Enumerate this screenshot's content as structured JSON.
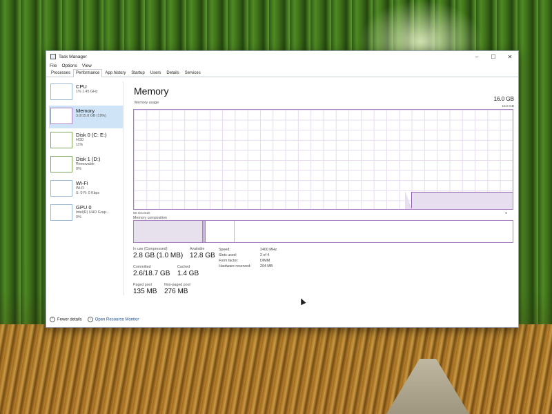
{
  "window": {
    "title": "Task Manager",
    "controls": {
      "minimize": "–",
      "maximize": "☐",
      "close": "✕"
    }
  },
  "menu": [
    "File",
    "Options",
    "View"
  ],
  "tabs": [
    "Processes",
    "Performance",
    "App history",
    "Startup",
    "Users",
    "Details",
    "Services"
  ],
  "active_tab": "Performance",
  "sidebar": {
    "items": [
      {
        "title": "CPU",
        "sub1": "1% 1.45 GHz",
        "sub2": ""
      },
      {
        "title": "Memory",
        "sub1": "3.0/15.8 GB (19%)",
        "sub2": ""
      },
      {
        "title": "Disk 0 (C: E:)",
        "sub1": "HDD",
        "sub2": "11%"
      },
      {
        "title": "Disk 1 (D:)",
        "sub1": "Removable",
        "sub2": "0%"
      },
      {
        "title": "Wi-Fi",
        "sub1": "Wi-Fi",
        "sub2": "S: 0 R: 0 Kbps"
      },
      {
        "title": "GPU 0",
        "sub1": "Intel(R) UHD Grap...",
        "sub2": "0%"
      }
    ]
  },
  "main": {
    "title": "Memory",
    "total": "16.0 GB",
    "usage_label": "Memory usage",
    "usage_max": "15.8 GB",
    "graph_current_fraction": 0.19,
    "axis_left": "60 seconds",
    "axis_right": "0",
    "composition_label": "Memory composition"
  },
  "stats": {
    "in_use_label": "In use (Compressed)",
    "in_use_value": "2.8 GB (1.0 MB)",
    "available_label": "Available",
    "available_value": "12.8 GB",
    "committed_label": "Committed",
    "committed_value": "2.6/18.7 GB",
    "cached_label": "Cached",
    "cached_value": "1.4 GB",
    "paged_label": "Paged pool",
    "paged_value": "135 MB",
    "nonpaged_label": "Non-paged pool",
    "nonpaged_value": "276 MB"
  },
  "specs": [
    {
      "key": "Speed:",
      "value": "2400 MHz"
    },
    {
      "key": "Slots used:",
      "value": "2 of 4"
    },
    {
      "key": "Form factor:",
      "value": "DIMM"
    },
    {
      "key": "Hardware reserved:",
      "value": "204 MB"
    }
  ],
  "footer": {
    "fewer_details": "Fewer details",
    "open_resource_monitor": "Open Resource Monitor"
  },
  "colors": {
    "memory_accent": "#8c5fb0",
    "selected_bg": "#cfe4f7"
  }
}
